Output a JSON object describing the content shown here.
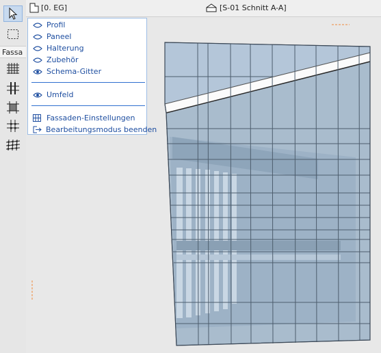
{
  "toolbox": {
    "tool_label": "Fassa",
    "tools": [
      {
        "name": "arrow-tool",
        "active": true
      },
      {
        "name": "marquee-tool",
        "active": false
      },
      {
        "name": "curtain-wall-grid-tool",
        "active": false
      },
      {
        "name": "frame-tool",
        "active": false
      },
      {
        "name": "panel-tool",
        "active": false
      },
      {
        "name": "junction-tool",
        "active": false
      },
      {
        "name": "accessory-tool",
        "active": false
      }
    ]
  },
  "tabs": {
    "floor_plan": "[0. EG]",
    "section": "[S-01 Schnitt A-A]"
  },
  "menu": {
    "items": [
      {
        "label": "Profil",
        "icon": "eye-icon"
      },
      {
        "label": "Paneel",
        "icon": "eye-icon"
      },
      {
        "label": "Halterung",
        "icon": "eye-icon"
      },
      {
        "label": "Zubehör",
        "icon": "eye-icon"
      },
      {
        "label": "Schema-Gitter",
        "icon": "eye-open-icon"
      },
      {
        "label": "Umfeld",
        "icon": "eye-open-icon"
      },
      {
        "label": "Fassaden-Einstellungen",
        "icon": "settings-grid-icon"
      },
      {
        "label": "Bearbeitungsmodus beenden",
        "icon": "exit-icon"
      }
    ]
  },
  "colors": {
    "accent": "#2f6fcf",
    "menu_text": "#1e4ea0",
    "glass": "#a9bccd",
    "marker": "#f08a3c"
  }
}
